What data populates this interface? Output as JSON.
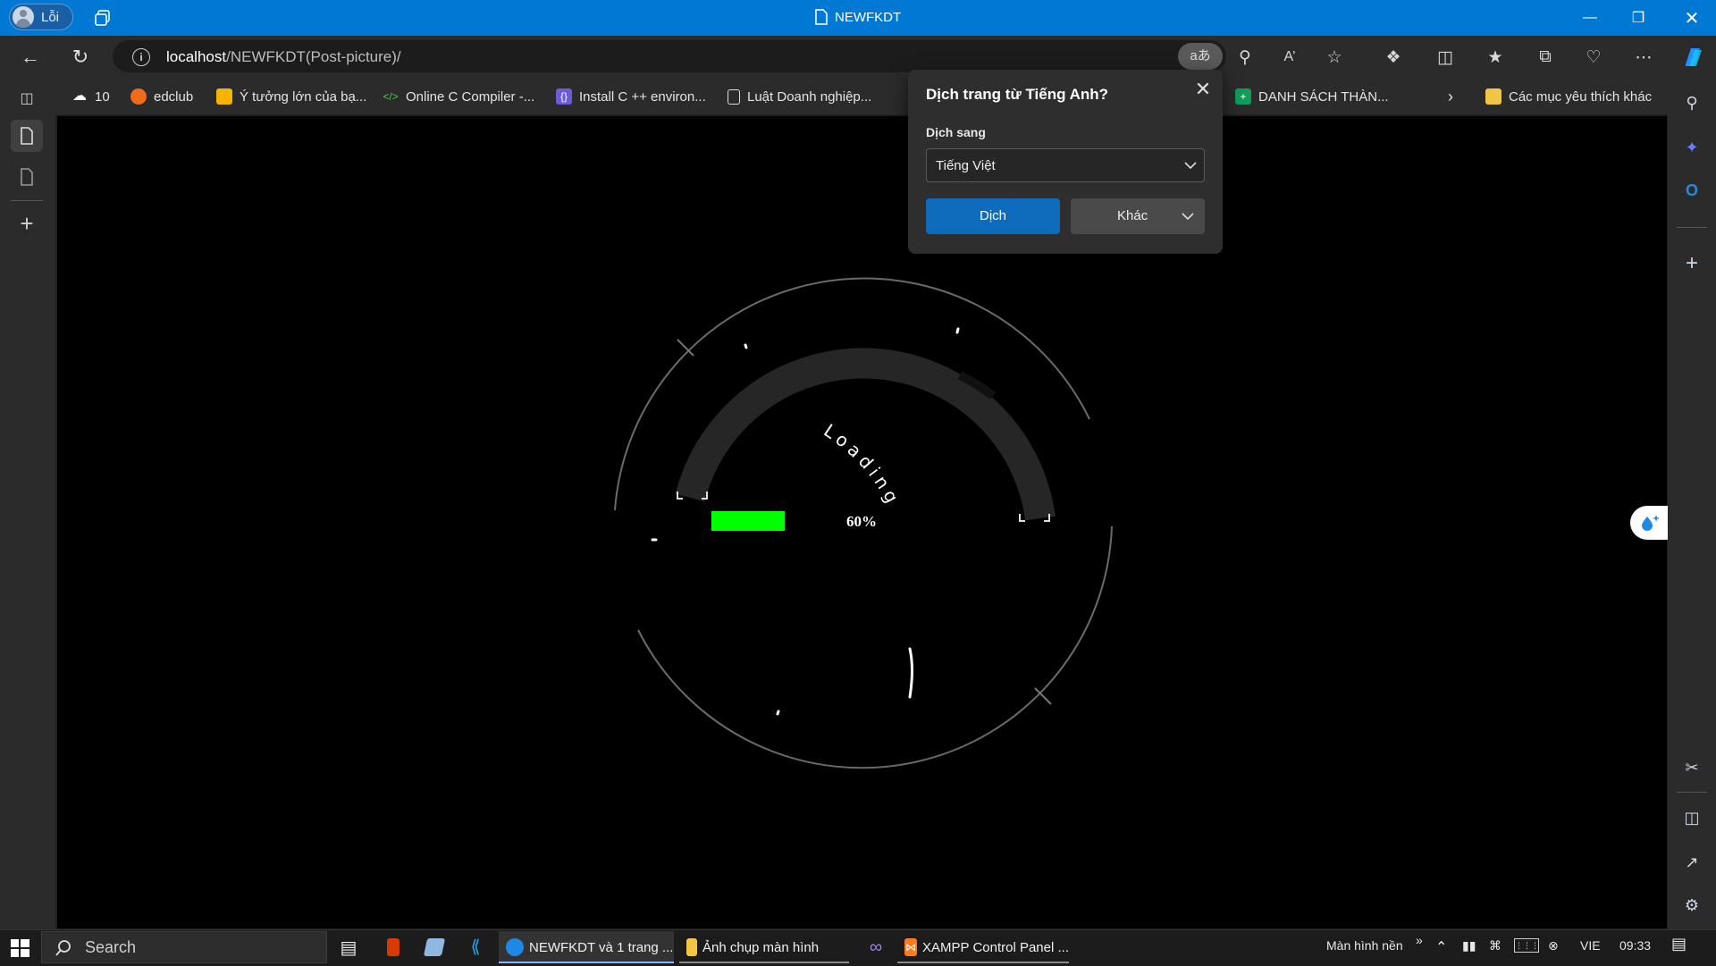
{
  "window": {
    "title": "NEWFKDT",
    "profile_name": "Lỗi"
  },
  "address_bar": {
    "url_host": "localhost",
    "url_path": "/NEWFKDT(Post-picture)/",
    "translate_badge": "aあ"
  },
  "favorites": [
    {
      "label": "10",
      "icon": "weather-icon"
    },
    {
      "label": "edclub",
      "icon": "edclub-icon"
    },
    {
      "label": "Ý tưởng lớn của bạ...",
      "icon": "slides-icon"
    },
    {
      "label": "Online C Compiler -...",
      "icon": "code-icon"
    },
    {
      "label": "Install C ++ environ...",
      "icon": "bracket-icon"
    },
    {
      "label": "Luật Doanh nghiệp...",
      "icon": "document-icon"
    },
    {
      "label": "DANH SÁCH THÀN...",
      "icon": "sheets-icon"
    },
    {
      "label": "Các mục yêu thích khác",
      "icon": "folder-icon"
    }
  ],
  "translate_popup": {
    "title": "Dịch trang từ Tiếng Anh?",
    "target_label": "Dịch sang",
    "target_language": "Tiếng Việt",
    "translate_button": "Dịch",
    "other_button": "Khác"
  },
  "page": {
    "loader_text": "Loading",
    "progress_percent": 60,
    "progress_label": "60%",
    "progress_color": "#00ff00"
  },
  "taskbar": {
    "search_placeholder": "Search",
    "apps": [
      {
        "label": "NEWFKDT và 1 trang ...",
        "active": true
      },
      {
        "label": "Ảnh chụp màn hình",
        "active": true
      },
      {
        "label": "XAMPP Control Panel ...",
        "active": true
      }
    ],
    "desktop_label": "Màn hình nền",
    "language": "VIE",
    "time": "09:33"
  },
  "colors": {
    "titlebar": "#0078d4",
    "chrome": "#2b2b2b",
    "accent": "#0f6cbd"
  }
}
